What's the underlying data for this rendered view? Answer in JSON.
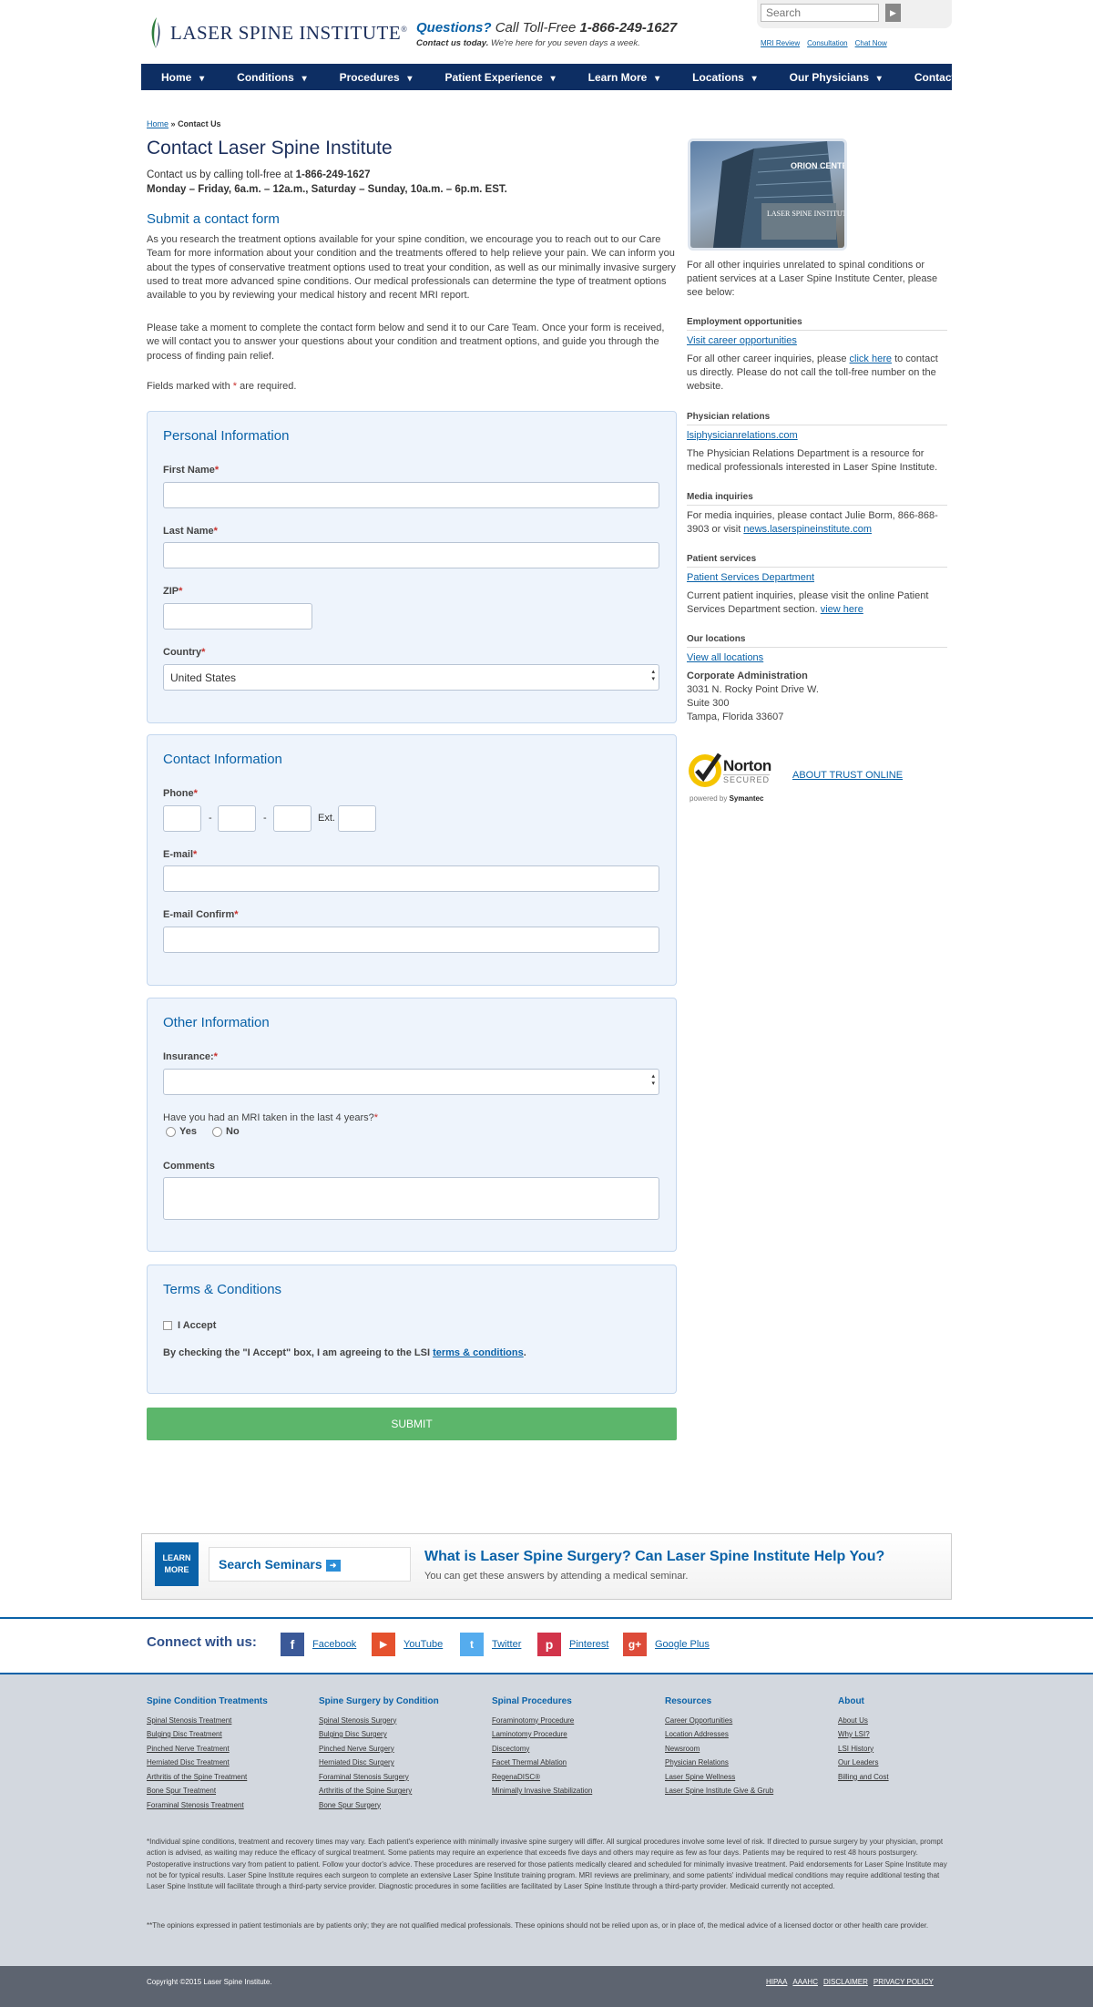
{
  "header": {
    "logo_text": "LASER SPINE INSTITUTE",
    "logo_mark": "®",
    "questions_label": "Questions?",
    "questions_text": "Call Toll-Free",
    "phone": "1-866-249-1627",
    "sub_bold": "Contact us today.",
    "sub_text": "We're here for you seven days a week.",
    "search_placeholder": "Search",
    "quick_links": [
      "MRI Review",
      "Consultation",
      "Chat Now"
    ]
  },
  "nav": [
    "Home",
    "Conditions",
    "Procedures",
    "Patient Experience",
    "Learn More",
    "Locations",
    "Our Physicians",
    "Contact"
  ],
  "breadcrumb": {
    "home": "Home",
    "sep": "»",
    "current": "Contact Us"
  },
  "page_title": "Contact Laser Spine Institute",
  "contact_intro": "Contact us by calling toll-free at",
  "contact_phone": "1-866-249-1627",
  "contact_hours": "Monday – Friday, 6a.m. – 12a.m., Saturday – Sunday, 10a.m. – 6p.m. EST.",
  "form_heading": "Submit a contact form",
  "para1": "As you research the treatment options available for your spine condition, we encourage you to reach out to our Care Team for more information about your condition and the treatments offered to help relieve your pain. We can inform you about the types of conservative treatment options used to treat your condition, as well as our minimally invasive surgery used to treat more advanced spine conditions. Our medical professionals can determine the type of treatment options available to you by reviewing your medical history and recent MRI report.",
  "para2": "Please take a moment to complete the contact form below and send it to our Care Team. Once your form is received, we will contact you to answer your questions about your condition and treatment options, and guide you through the process of finding pain relief.",
  "required_note_pre": "Fields marked with",
  "required_note_post": "are required.",
  "personal": {
    "title": "Personal Information",
    "first_name": "First Name",
    "last_name": "Last Name",
    "zip": "ZIP",
    "country": "Country",
    "country_value": "United States"
  },
  "contact": {
    "title": "Contact Information",
    "phone": "Phone",
    "ext": "Ext.",
    "dash": "-",
    "email": "E-mail",
    "email_confirm": "E-mail Confirm"
  },
  "other": {
    "title": "Other Information",
    "insurance": "Insurance:",
    "mri_question": "Have you had an MRI taken in the last 4 years?",
    "yes": "Yes",
    "no": "No",
    "comments": "Comments"
  },
  "terms": {
    "title": "Terms & Conditions",
    "accept": "I Accept",
    "agree_pre": "By checking the \"I Accept\" box, I am agreeing to the LSI",
    "agree_link": "terms & conditions",
    "agree_post": "."
  },
  "submit_label": "SUBMIT",
  "required_star": "*",
  "sidebar": {
    "photo_sign_top": "ORION CENTER",
    "photo_sign": "LASER SPINE INSTITUTE",
    "intro": "For all other inquiries unrelated to spinal conditions or patient services at a Laser Spine Institute Center, please see below:",
    "employment_h": "Employment opportunities",
    "employment_link": "Visit career opportunities",
    "employment_pre": "For all other career inquiries, please",
    "employment_click": "click here",
    "employment_post": "to contact us directly. Please do not call the toll-free number on the website.",
    "physician_h": "Physician relations",
    "physician_link": "lsiphysicianrelations.com",
    "physician_text": "The Physician Relations Department is a resource for medical professionals interested in Laser Spine Institute.",
    "media_h": "Media inquiries",
    "media_text": "For media inquiries, please contact Julie Borm, 866-868-3903 or visit",
    "media_link": "news.laserspineinstitute.com",
    "patient_h": "Patient services",
    "patient_link": "Patient Services Department",
    "patient_text": "Current patient inquiries, please visit the online Patient Services Department section.",
    "patient_view": "view here",
    "locations_h": "Our locations",
    "locations_link": "View all locations",
    "corp_title": "Corporate Administration",
    "corp_line1": "3031 N. Rocky Point Drive W.",
    "corp_line2": "Suite 300",
    "corp_line3": "Tampa, Florida 33607",
    "norton_name": "Norton",
    "norton_secured": "SECURED",
    "norton_powered": "powered by",
    "norton_brand": "Symantec",
    "trust_link": "ABOUT TRUST ONLINE"
  },
  "seminar": {
    "learn": "LEARN MORE",
    "search": "Search Seminars",
    "title": "What is Laser Spine Surgery? Can Laser Spine Institute Help You?",
    "sub": "You can get these answers by attending a medical seminar."
  },
  "connect": {
    "label": "Connect with us:",
    "networks": [
      "Facebook",
      "YouTube",
      "Twitter",
      "Pinterest",
      "Google Plus"
    ]
  },
  "footer_cols": [
    {
      "title": "Spine Condition Treatments",
      "items": [
        "Spinal Stenosis Treatment",
        "Bulging Disc Treatment",
        "Pinched Nerve Treatment",
        "Herniated Disc Treatment",
        "Arthritis of the Spine Treatment",
        "Bone Spur Treatment",
        "Foraminal Stenosis Treatment"
      ]
    },
    {
      "title": "Spine Surgery by Condition",
      "items": [
        "Spinal Stenosis Surgery",
        "Bulging Disc Surgery",
        "Pinched Nerve Surgery",
        "Herniated Disc Surgery",
        "Foraminal Stenosis Surgery",
        "Arthritis of the Spine Surgery",
        "Bone Spur Surgery"
      ]
    },
    {
      "title": "Spinal Procedures",
      "items": [
        "Foraminotomy Procedure",
        "Laminotomy Procedure",
        "Discectomy",
        "Facet Thermal Ablation",
        "RegenaDISC®",
        "Minimally Invasive Stabilization"
      ]
    },
    {
      "title": "Resources",
      "items": [
        "Career Opportunities",
        "Location Addresses",
        "Newsroom",
        "Physician Relations",
        "Laser Spine Wellness",
        "Laser Spine Institute Give & Grub"
      ]
    },
    {
      "title": "About",
      "items": [
        "About Us",
        "Why LSI?",
        "LSI History",
        "Our Leaders",
        "Billing and Cost"
      ]
    }
  ],
  "disclaimer1": "*Individual spine conditions, treatment and recovery times may vary. Each patient's experience with minimally invasive spine surgery will differ. All surgical procedures involve some level of risk. If directed to pursue surgery by your physician, prompt action is advised, as waiting may reduce the efficacy of surgical treatment. Some patients may require an experience that exceeds five days and others may require as few as four days. Patients may be required to rest 48 hours postsurgery. Postoperative instructions vary from patient to patient. Follow your doctor's advice. These procedures are reserved for those patients medically cleared and scheduled for minimally invasive treatment. Paid endorsements for Laser Spine Institute may not be for typical results. Laser Spine Institute requires each surgeon to complete an extensive Laser Spine Institute training program. MRI reviews are preliminary, and some patients' individual medical conditions may require additional testing that Laser Spine Institute will facilitate through a third-party service provider. Diagnostic procedures in some facilities are facilitated by Laser Spine Institute through a third-party provider. Medicaid currently not accepted.",
  "disclaimer2": "**The opinions expressed in patient testimonials are by patients only; they are not qualified medical professionals. These opinions should not be relied upon as, or in place of, the medical advice of a licensed doctor or other health care provider.",
  "copyright": "Copyright ©2015 Laser Spine Institute.",
  "bottom_links": [
    "HIPAA",
    "AAAHC",
    "DISCLAIMER",
    "PRIVACY POLICY"
  ]
}
